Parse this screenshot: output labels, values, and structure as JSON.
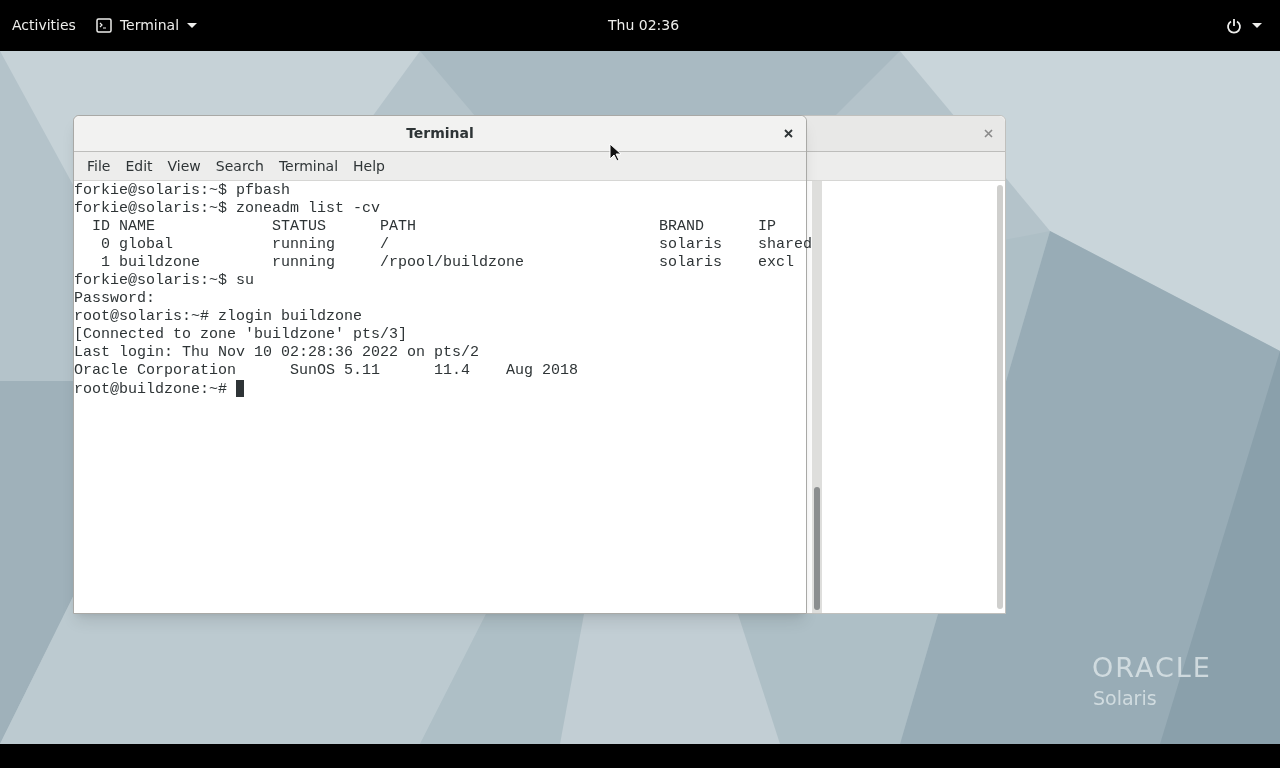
{
  "top_bar": {
    "activities": "Activities",
    "app_menu": "Terminal",
    "clock": "Thu 02:36"
  },
  "terminal": {
    "title": "Terminal",
    "menu": [
      "File",
      "Edit",
      "View",
      "Search",
      "Terminal",
      "Help"
    ],
    "lines": [
      "forkie@solaris:~$ pfbash",
      "forkie@solaris:~$ zoneadm list -cv",
      "  ID NAME             STATUS      PATH                           BRAND      IP",
      "   0 global           running     /                              solaris    shared",
      "   1 buildzone        running     /rpool/buildzone               solaris    excl",
      "forkie@solaris:~$ su",
      "Password:",
      "root@solaris:~# zlogin buildzone",
      "[Connected to zone 'buildzone' pts/3]",
      "Last login: Thu Nov 10 02:28:36 2022 on pts/2",
      "Oracle Corporation      SunOS 5.11      11.4    Aug 2018"
    ],
    "prompt": "root@buildzone:~# "
  },
  "desktop": {
    "logo": "ORACLE",
    "logo_subtitle": "Solaris"
  }
}
